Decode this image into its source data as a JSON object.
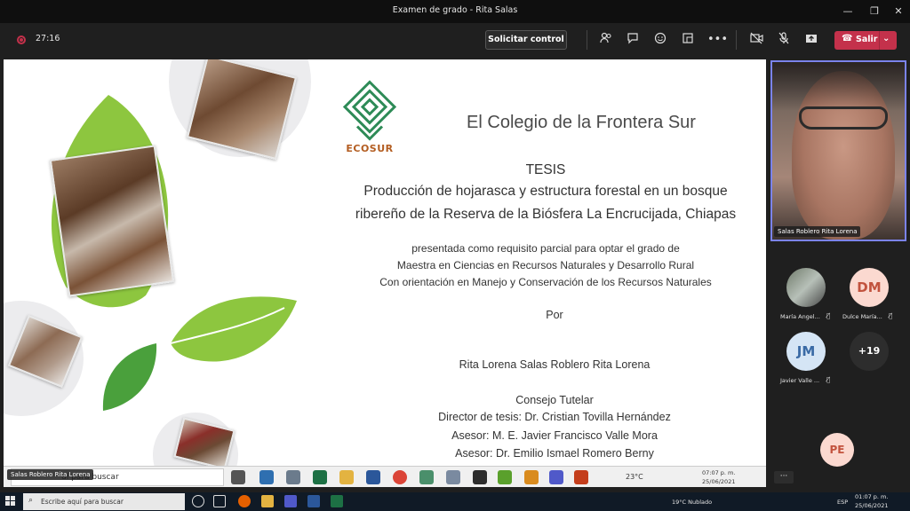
{
  "window": {
    "title": "Examen de grado - Rita Salas"
  },
  "toolbar": {
    "timer": "27:16",
    "request_control": "Solicitar control",
    "leave": "Salir"
  },
  "slide": {
    "logo_text": "ECOSUR",
    "institution": "El Colegio de la Frontera Sur",
    "tesis": "TESIS",
    "title_line1": "Producción de hojarasca y estructura forestal en un bosque",
    "title_line2": "ribereño de la Reserva de la Biósfera La Encrucijada, Chiapas",
    "presented_line1": "presentada como requisito parcial para optar el grado de",
    "presented_line2": "Maestra en Ciencias en Recursos Naturales y Desarrollo Rural",
    "presented_line3": "Con orientación en Manejo y Conservación de los Recursos Naturales",
    "por": "Por",
    "author": "Rita Lorena Salas Roblero Rita Lorena",
    "consejo": "Consejo Tutelar",
    "director": "Director de tesis: Dr. Cristian Tovilla Hernández",
    "asesor1": "Asesor: M. E. Javier Francisco Valle Mora",
    "asesor2": "Asesor: Dr. Emilio Ismael Romero Berny"
  },
  "shared_screen": {
    "search_placeholder": "uí para buscar",
    "presenter_tag": "Salas Roblero Rita Lorena",
    "temperature": "23°C",
    "clock_time": "07:07 p. m.",
    "clock_date": "25/06/2021"
  },
  "participants": {
    "speaker_name": "Salas Roblero Rita Lorena",
    "list": [
      {
        "initials": "",
        "label": "María Angel..."
      },
      {
        "initials": "DM",
        "label": "Dulce María..."
      },
      {
        "initials": "JM",
        "label": "Javier Valle ..."
      },
      {
        "initials": "+19",
        "label": ""
      }
    ],
    "extra_initials": "PE",
    "more": "···"
  },
  "taskbar": {
    "search_placeholder": "Escribe aquí para buscar",
    "weather": "19°C  Nublado",
    "lang": "ESP",
    "time": "01:07 p. m.",
    "date": "25/06/2021"
  },
  "colors": {
    "accent": "#7b83eb",
    "leave": "#c4314b",
    "leaf_light": "#8dc63f",
    "leaf_dark": "#4aa03c",
    "ecosur_green": "#2e8b57",
    "ecosur_orange": "#b35d21"
  }
}
